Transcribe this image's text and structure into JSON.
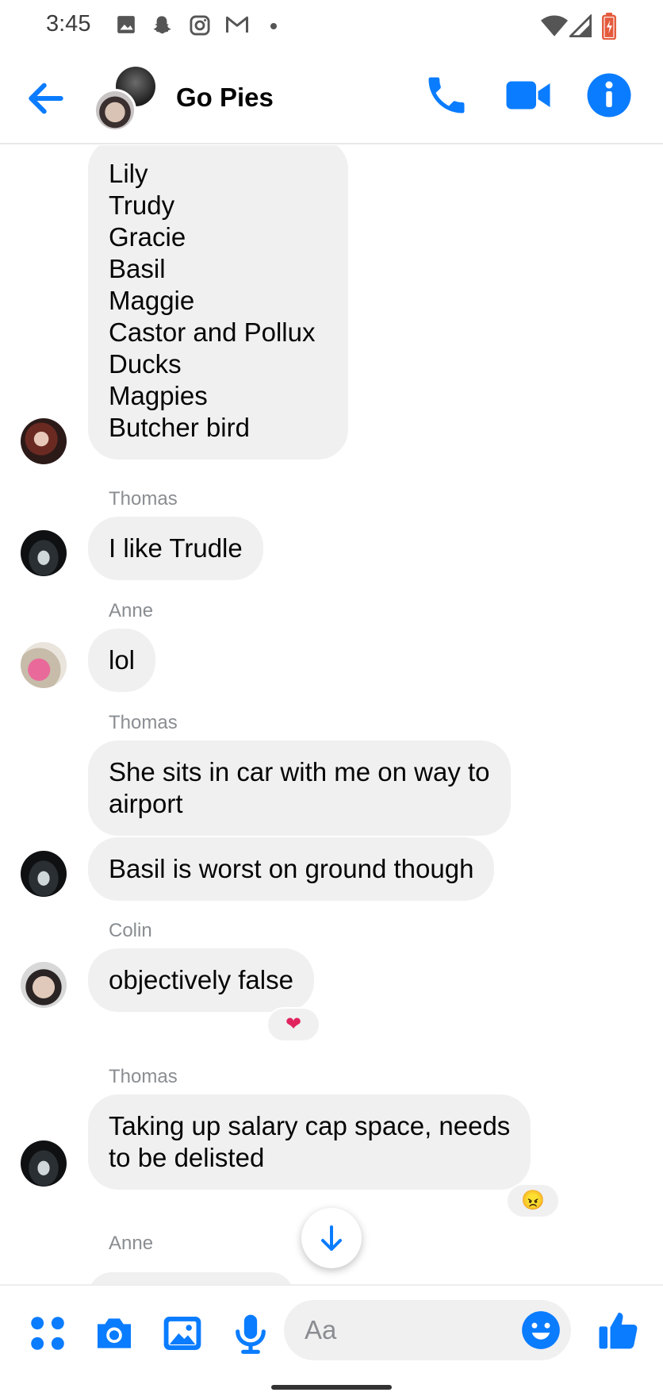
{
  "status_bar": {
    "time": "3:45",
    "notification_icons": [
      "image-icon",
      "snapchat-icon",
      "instagram-icon",
      "gmail-icon",
      "dot-icon"
    ],
    "system_icons": [
      "wifi-icon",
      "cellular-icon",
      "battery-icon"
    ]
  },
  "header": {
    "title": "Go Pies",
    "actions": [
      "phone-icon",
      "video-icon",
      "info-icon"
    ],
    "accent_color": "#0a7cff"
  },
  "messages": [
    {
      "sender": "",
      "text": "Lily\nTrudy\nGracie\nBasil\nMaggie\nCastor and Pollux\nDucks\nMagpies\nButcher bird"
    },
    {
      "sender": "Thomas",
      "text": "I like Trudle"
    },
    {
      "sender": "Anne",
      "text": "lol"
    },
    {
      "sender": "Thomas",
      "text": "She sits in car with me on way to\nairport"
    },
    {
      "sender": "",
      "text": "Basil is worst on ground though"
    },
    {
      "sender": "Colin",
      "text": "objectively false",
      "reaction": "❤"
    },
    {
      "sender": "Thomas",
      "text": "Taking up salary cap space, needs\nto be delisted",
      "reaction": "😠"
    },
    {
      "sender": "Anne",
      "text": ""
    }
  ],
  "composer": {
    "placeholder": "Aa",
    "icons": [
      "menu-dots-icon",
      "camera-icon",
      "gallery-icon",
      "microphone-icon",
      "emoji-icon",
      "thumbs-up-icon"
    ]
  }
}
